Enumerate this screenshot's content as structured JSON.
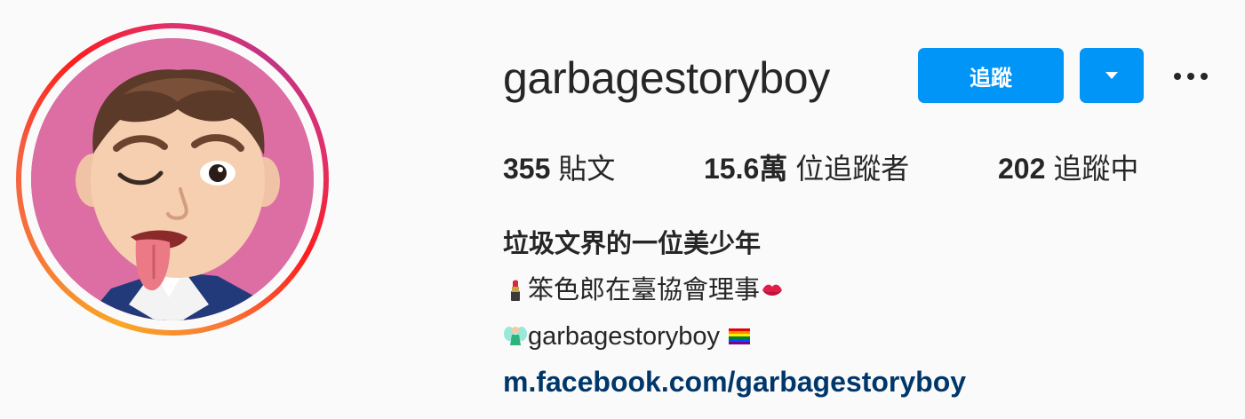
{
  "profile": {
    "username": "garbagestoryboy",
    "follow_label": "追蹤",
    "stats": {
      "posts_count": "355",
      "posts_label": "貼文",
      "followers_count": "15.6萬",
      "followers_label": "位追蹤者",
      "following_count": "202",
      "following_label": "追蹤中"
    },
    "bio": {
      "name": "垃圾文界的一位美少年",
      "line1": "笨色郎在臺協會理事",
      "line2": "garbagestoryboy",
      "link": "m.facebook.com/garbagestoryboy"
    }
  },
  "icons": {
    "dropdown": "chevron-down-icon",
    "more": "more-options-icon",
    "lipstick": "lipstick-emoji",
    "kiss": "kiss-mark-emoji",
    "fairy": "fairy-emoji",
    "rainbow": "rainbow-flag-emoji"
  },
  "colors": {
    "primary_button": "#0095f6",
    "link": "#00376b",
    "text": "#262626",
    "avatar_background": "#dc6ea3"
  }
}
